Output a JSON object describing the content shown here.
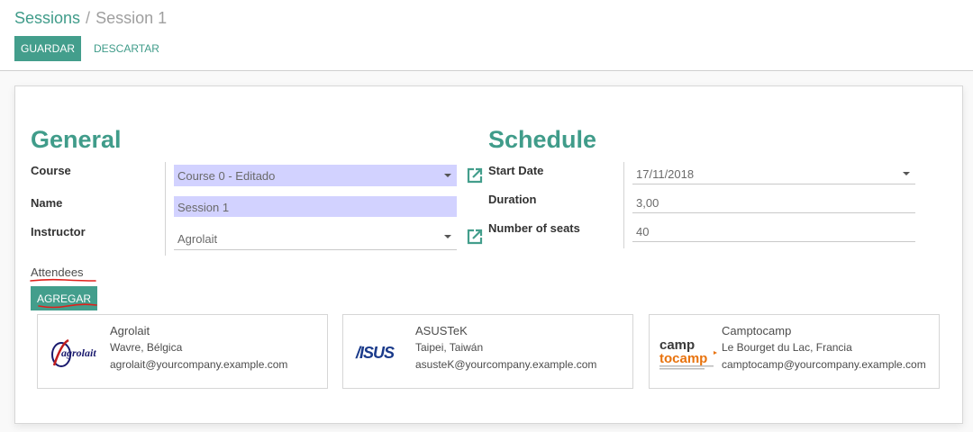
{
  "breadcrumb": {
    "parent": "Sessions",
    "separator": "/",
    "current": "Session 1"
  },
  "toolbar": {
    "save_label": "GUARDAR",
    "discard_label": "DESCARTAR"
  },
  "general": {
    "title": "General",
    "course_label": "Course",
    "course_value": "Course 0 - Editado",
    "name_label": "Name",
    "name_value": "Session 1",
    "instructor_label": "Instructor",
    "instructor_value": "Agrolait"
  },
  "schedule": {
    "title": "Schedule",
    "start_date_label": "Start Date",
    "start_date_value": "17/11/2018",
    "duration_label": "Duration",
    "duration_value": "3,00",
    "seats_label": "Number of seats",
    "seats_value": "40"
  },
  "attendees": {
    "label": "Attendees",
    "add_label": "AGREGAR",
    "cards": [
      {
        "name": "Agrolait",
        "address": "Wavre, Bélgica",
        "email": "agrolait@yourcompany.example.com",
        "logo_icon": "agrolait-logo",
        "logo_text": "agrolait"
      },
      {
        "name": "ASUSTeK",
        "address": "Taipei, Taiwán",
        "email": "asusteK@yourcompany.example.com",
        "logo_icon": "asus-logo",
        "logo_text": "/ISUS"
      },
      {
        "name": "Camptocamp",
        "address": "Le Bourget du Lac, Francia",
        "email": "camptocamp@yourcompany.example.com",
        "logo_icon": "camptocamp-logo",
        "logo_text_top": "camp",
        "logo_text_bottom": "tocamp"
      }
    ]
  },
  "colors": {
    "primary": "#439e8c",
    "required_field_bg": "#d2d2ff",
    "annotation_red": "#e0201b"
  }
}
